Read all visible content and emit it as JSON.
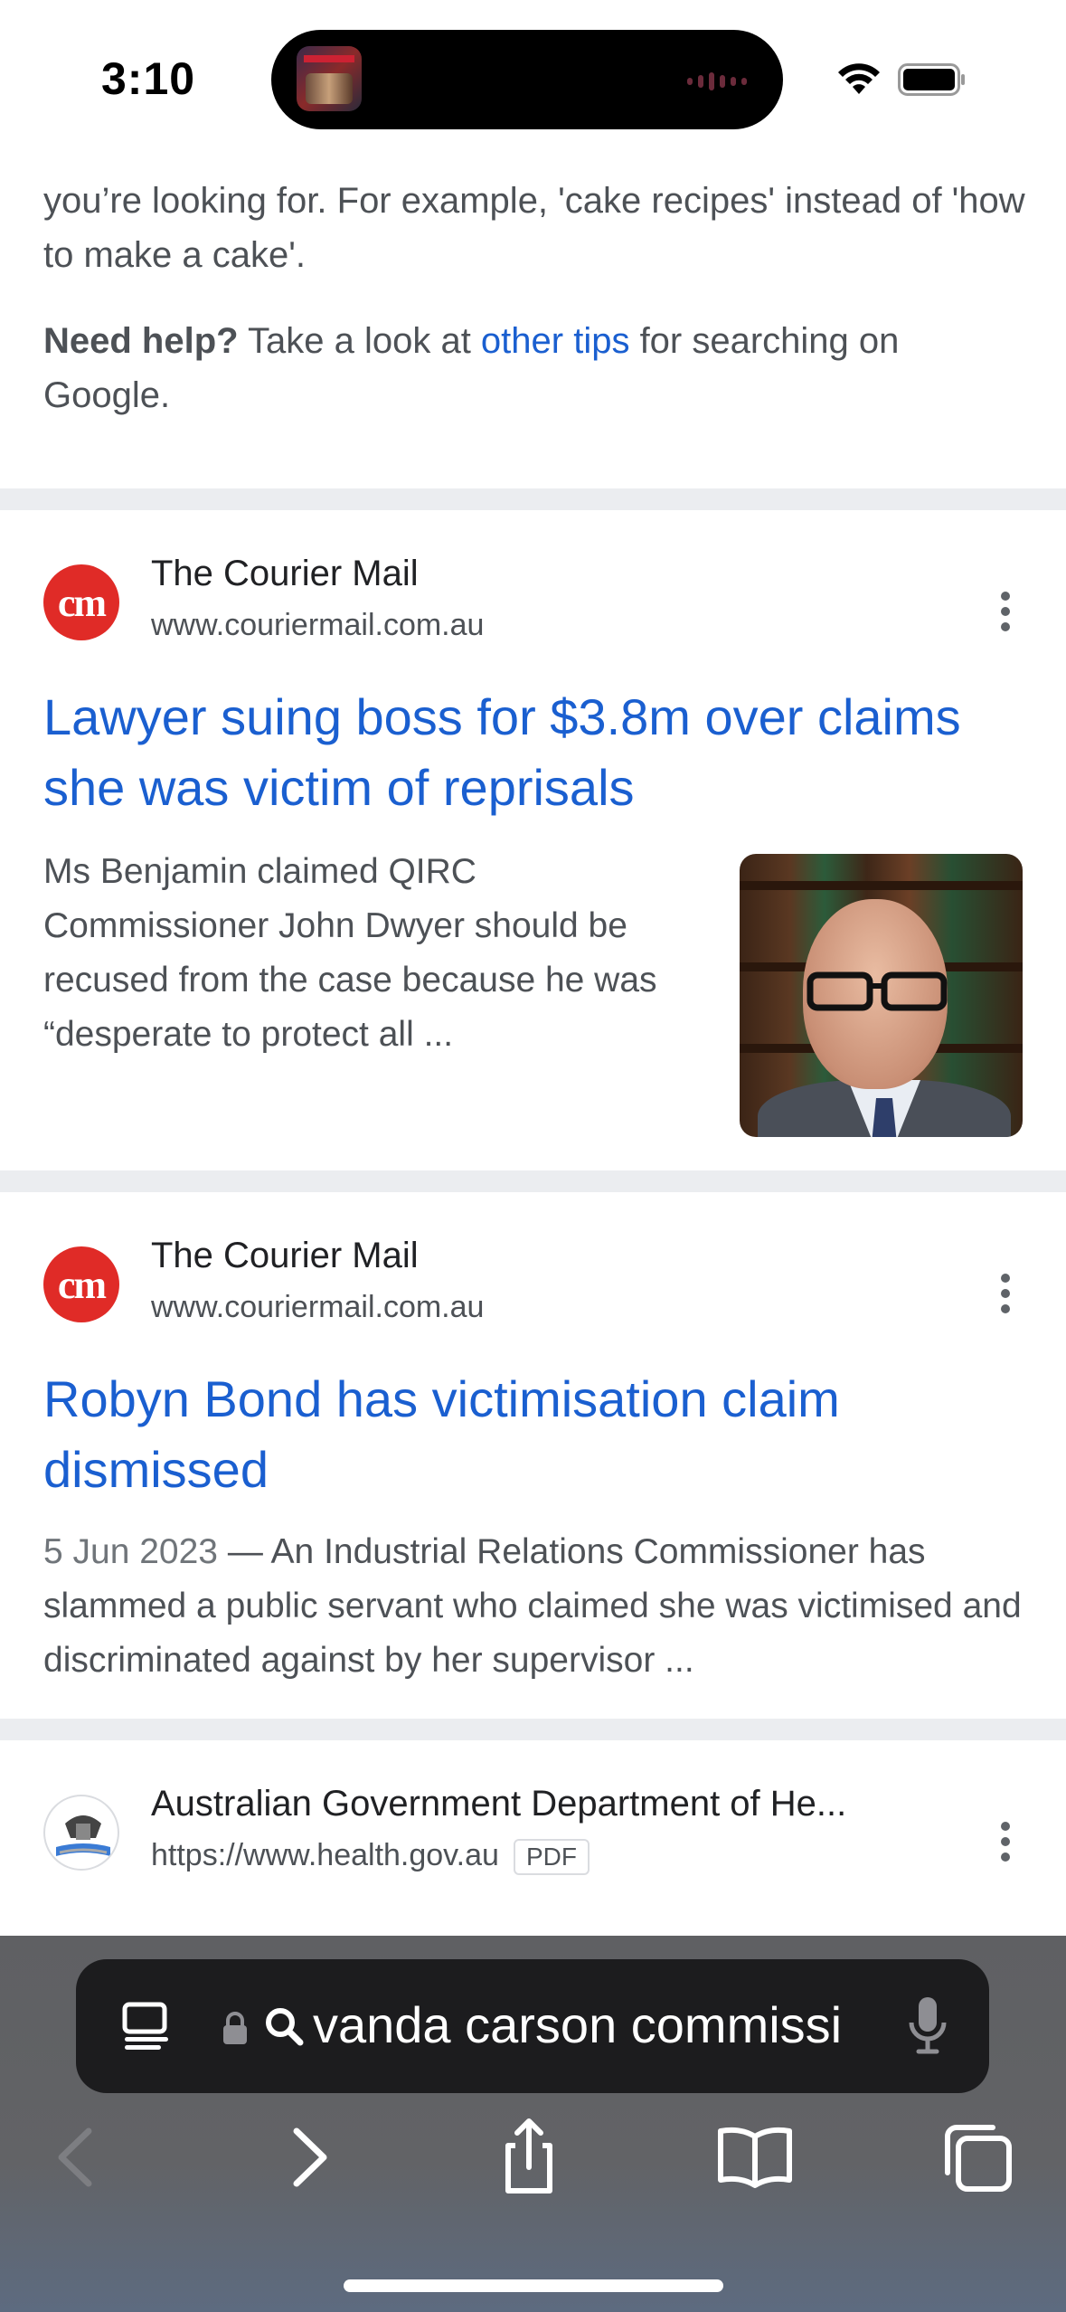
{
  "status_bar": {
    "time": "3:10"
  },
  "tips": {
    "example_text": "you’re looking for. For example, 'cake recipes' instead of 'how to make a cake'.",
    "need_help_bold": "Need help?",
    "need_help_pre": " Take a look at ",
    "need_help_link": "other tips",
    "need_help_post": " for searching on Google."
  },
  "results": [
    {
      "site_name": "The Courier Mail",
      "site_url": "www.couriermail.com.au",
      "favicon": "cm",
      "title": "Lawyer suing boss for $3.8m over claims she was victim of reprisals",
      "snippet": "Ms Benjamin claimed QIRC Commissioner John Dwyer should be recused from the case because he was “desperate to protect all ..."
    },
    {
      "site_name": "The Courier Mail",
      "site_url": "www.couriermail.com.au",
      "favicon": "cm",
      "title": "Robyn Bond has victimisation claim dismissed",
      "date": "5 Jun 2023",
      "date_sep": " — ",
      "snippet": "An Industrial Relations Commissioner has slammed a public servant who claimed she was victimised and discriminated against by her supervisor ..."
    },
    {
      "site_name": "Australian Government Department of He...",
      "site_url": "https://www.health.gov.au",
      "badge": "PDF"
    }
  ],
  "address_bar": {
    "query": "vanda carson commissi"
  },
  "colors": {
    "link": "#1a5fd0",
    "separator": "#ebedf0",
    "courier_red": "#e02b27",
    "toolbar": "#626366"
  }
}
